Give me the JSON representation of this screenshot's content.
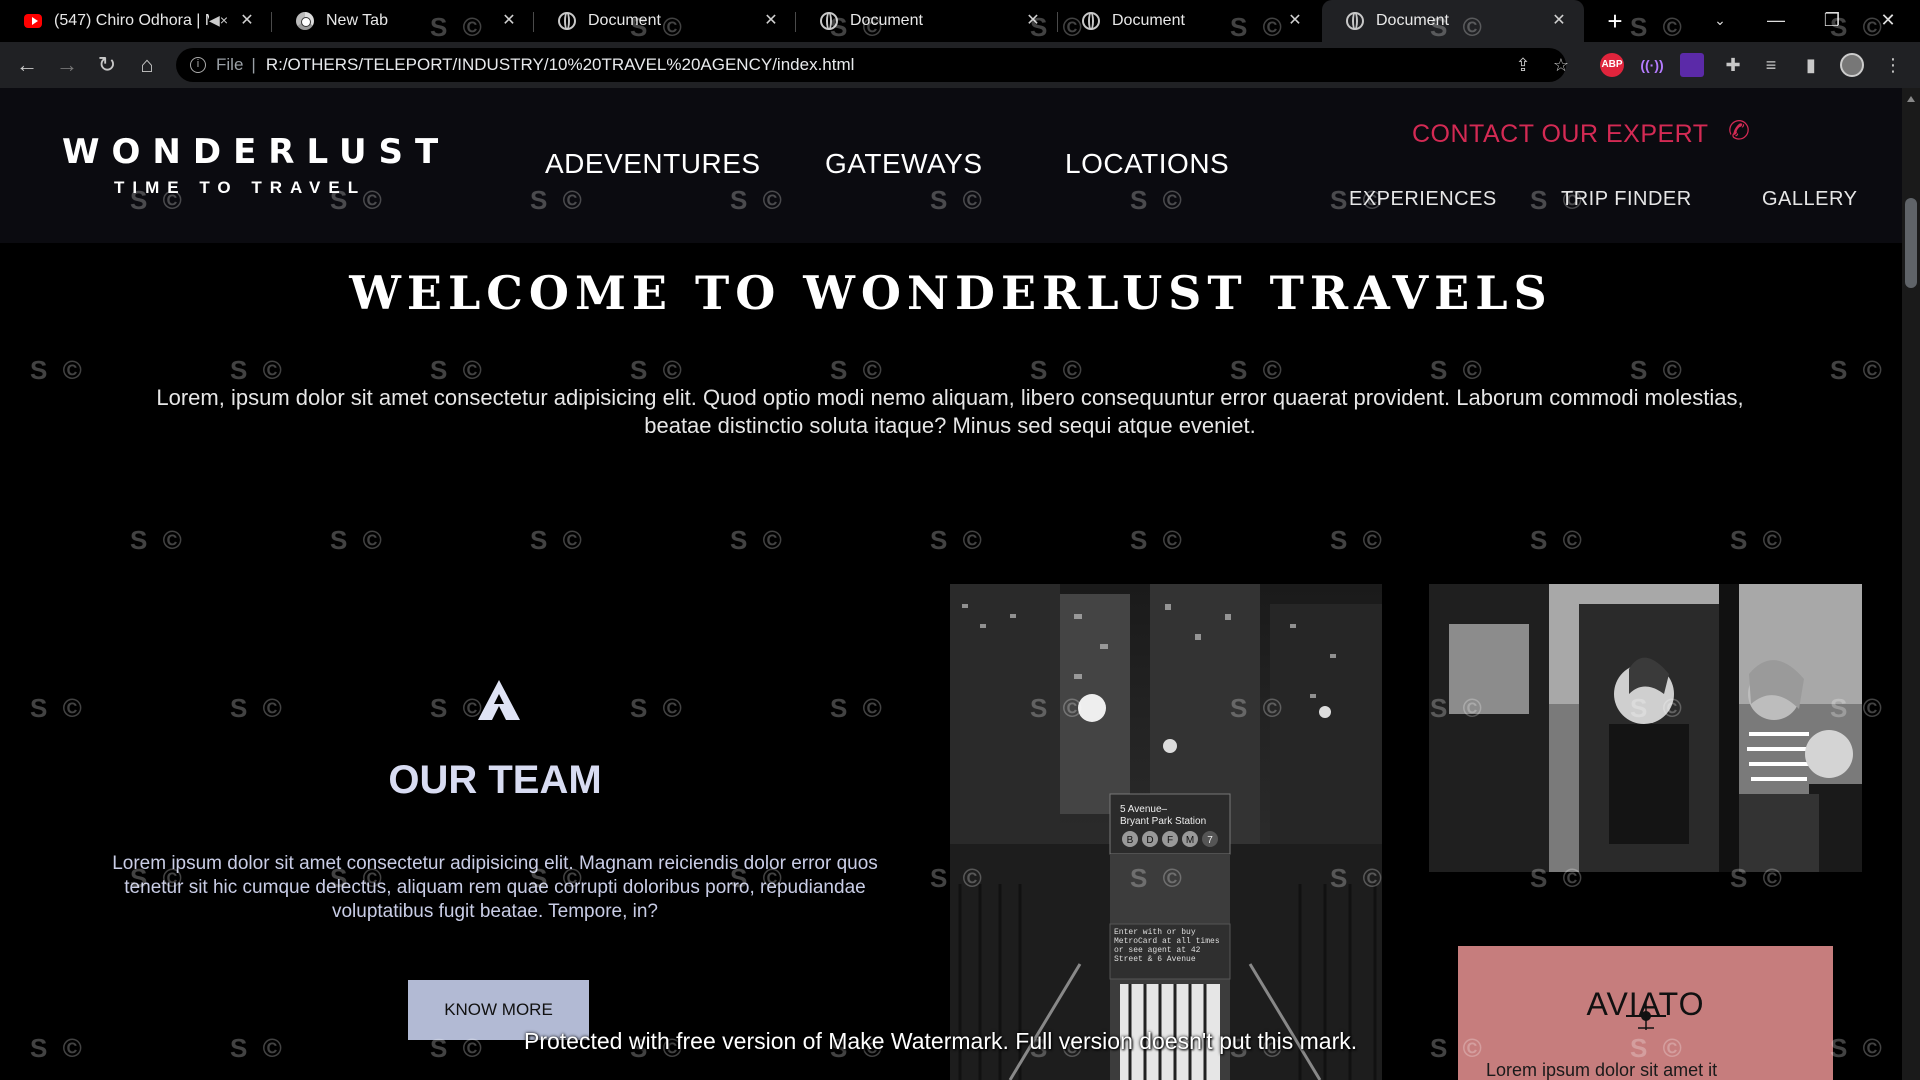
{
  "browser": {
    "tabs": [
      {
        "title": "(547) Chiro Odhora | M",
        "favicon": "youtube-icon",
        "muted": true,
        "active": false
      },
      {
        "title": "New Tab",
        "favicon": "chrome-icon",
        "active": false
      },
      {
        "title": "Document",
        "favicon": "globe-icon",
        "active": false
      },
      {
        "title": "Document",
        "favicon": "globe-icon",
        "active": false
      },
      {
        "title": "Document",
        "favicon": "globe-icon",
        "active": false
      },
      {
        "title": "Document",
        "favicon": "globe-icon",
        "active": true
      }
    ],
    "address": {
      "protocol_label": "File",
      "url": "R:/OTHERS/TELEPORT/INDUSTRY/10%20TRAVEL%20AGENCY/index.html"
    },
    "extensions": [
      "ABP"
    ]
  },
  "site": {
    "logo": {
      "title": "WONDERLUST",
      "subtitle": "TIME TO TRAVEL"
    },
    "main_nav": [
      "ADEVENTURES",
      "GATEWAYS",
      "LOCATIONS"
    ],
    "contact_label": "CONTACT OUR EXPERT",
    "sub_nav": [
      "EXPERIENCES",
      "TRIP FINDER",
      "GALLERY"
    ],
    "welcome_heading": "WELCOME TO WONDERLUST TRAVELS",
    "intro_text": "Lorem, ipsum dolor sit amet consectetur adipisicing elit. Quod optio modi nemo aliquam, libero consequuntur error quaerat provident. Laborum commodi molestias, beatae distinctio soluta itaque? Minus sed sequi atque eveniet.",
    "team": {
      "title": "OUR TEAM",
      "text": "Lorem ipsum dolor sit amet consectetur adipisicing elit. Magnam reiciendis dolor error quos tenetur sit hic cumque delectus, aliquam rem quae corrupti doloribus porro, repudiandae voluptatibus fugit beatae. Tempore, in?",
      "button_label": "KNOW MORE"
    },
    "subway_sign": {
      "line1": "5 Avenue–",
      "line2": "Bryant Park Station",
      "lines": [
        "B",
        "D",
        "F",
        "M",
        "7"
      ],
      "notice": "Enter with or buy MetroCard at all times or see agent at 42 Street & 6 Avenue"
    },
    "aviato": {
      "logo": "AVIATO",
      "text": "Lorem ipsum dolor sit amet it"
    }
  },
  "watermark": {
    "tile_text": "S ©",
    "banner": "Protected with free version of Make Watermark. Full version doesn't put this mark."
  },
  "colors": {
    "accent_red": "#d42a54",
    "button_bg": "#b2bad4",
    "aviato_bg": "#c67d7d",
    "header_bg": "#0b0b10"
  }
}
